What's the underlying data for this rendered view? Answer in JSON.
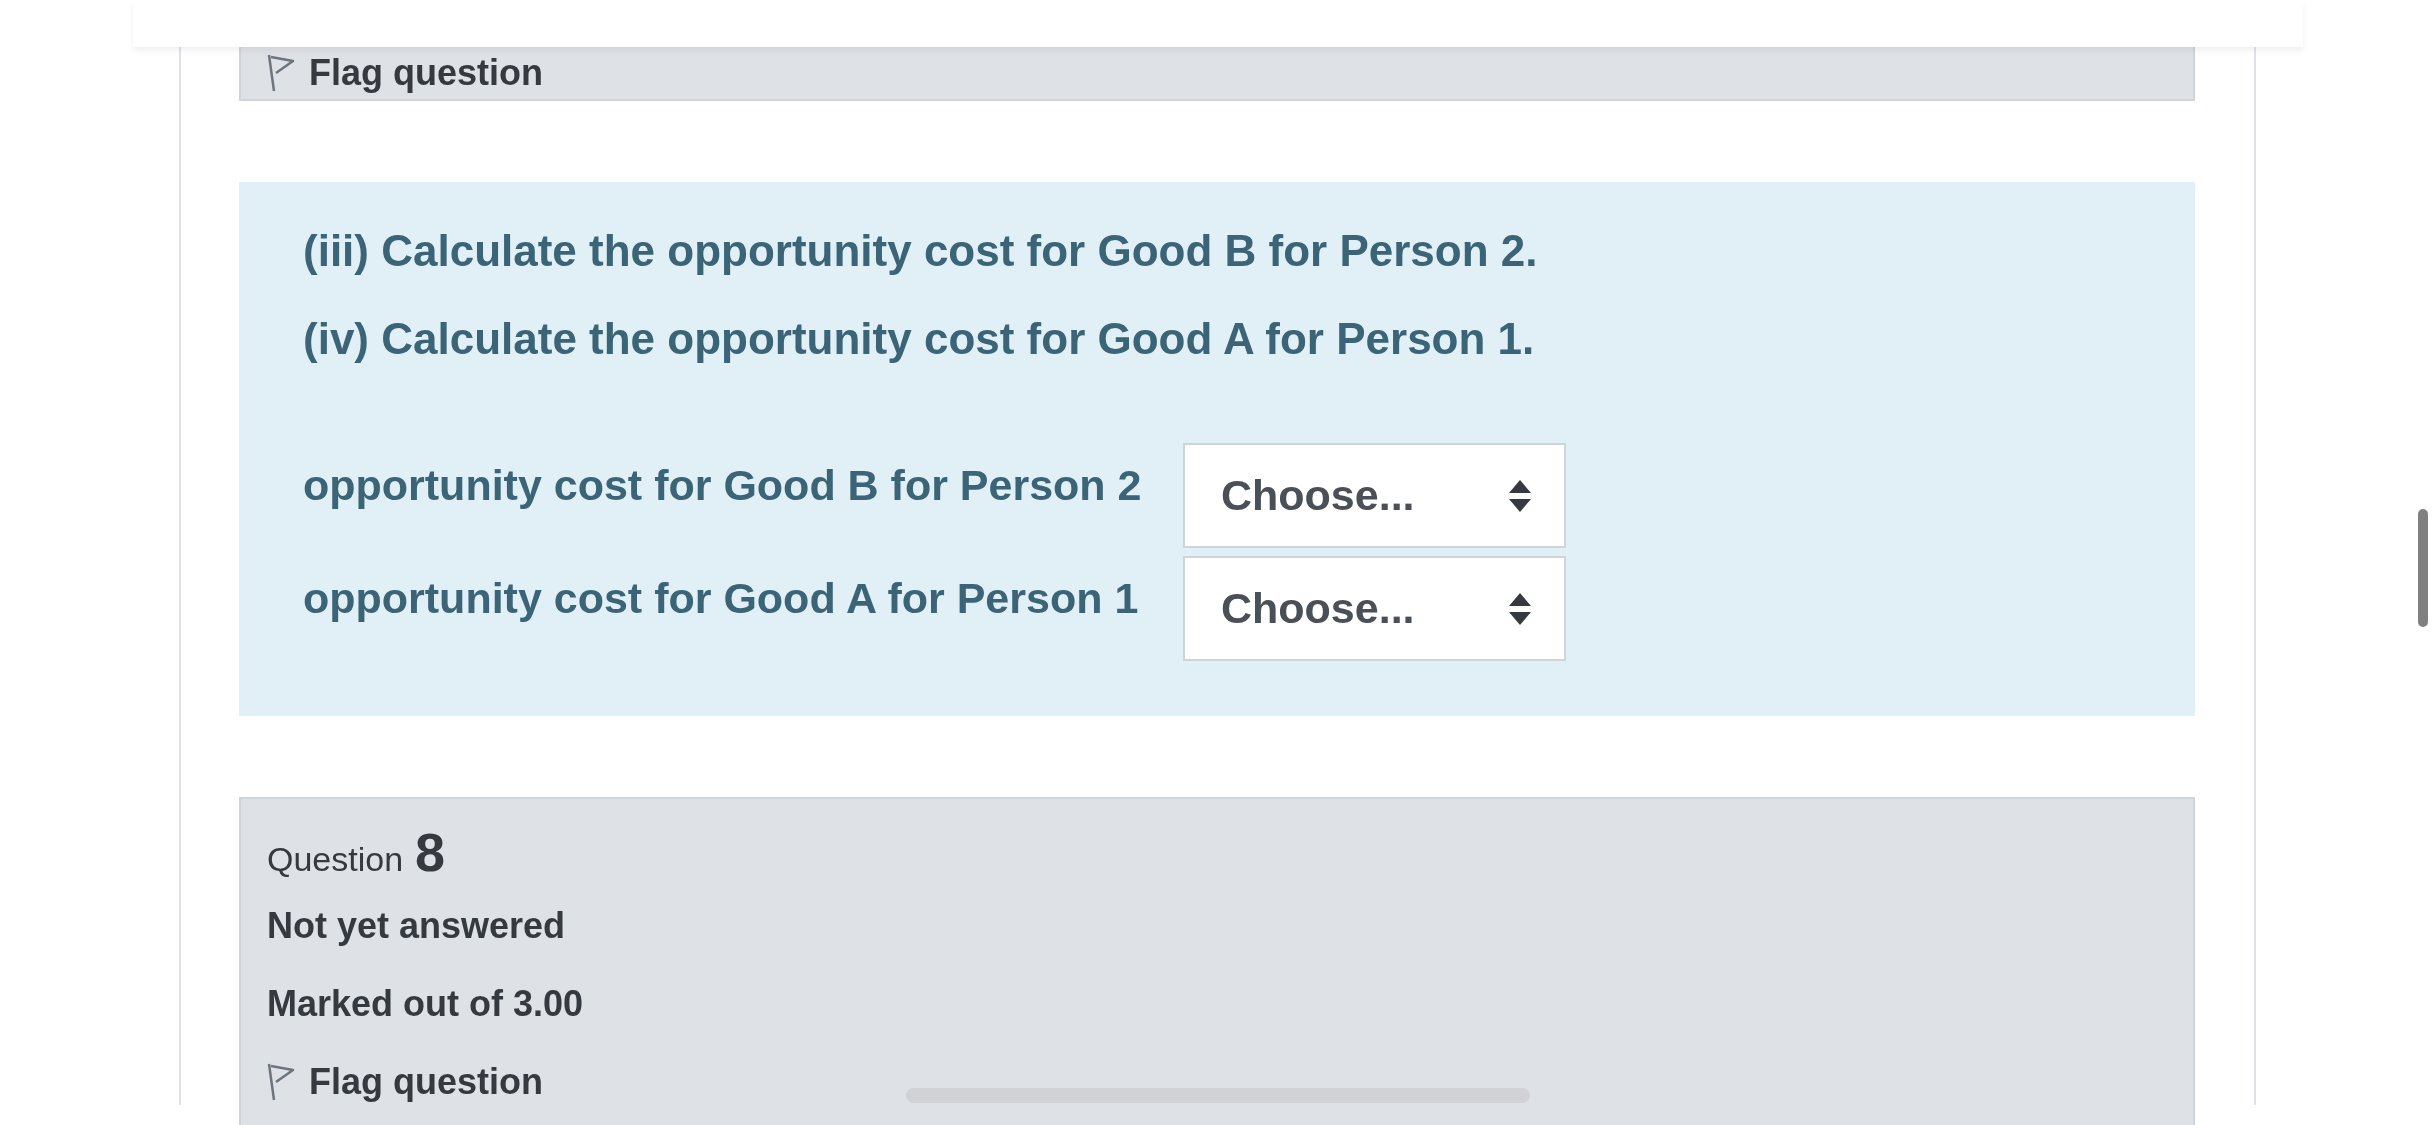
{
  "previous_question": {
    "flag_label": "Flag question"
  },
  "question_text": [
    "(iii) Calculate the opportunity cost for Good B for Person 2.",
    "(iv) Calculate the opportunity cost for Good A for Person 1."
  ],
  "answers": [
    {
      "label": "opportunity cost for Good B for Person 2",
      "value": "Choose..."
    },
    {
      "label": "opportunity cost for Good A for Person 1",
      "value": "Choose..."
    }
  ],
  "next_question": {
    "label": "Question",
    "number": "8",
    "status": "Not yet answered",
    "marks": "Marked out of 3.00",
    "flag_label": "Flag question"
  }
}
